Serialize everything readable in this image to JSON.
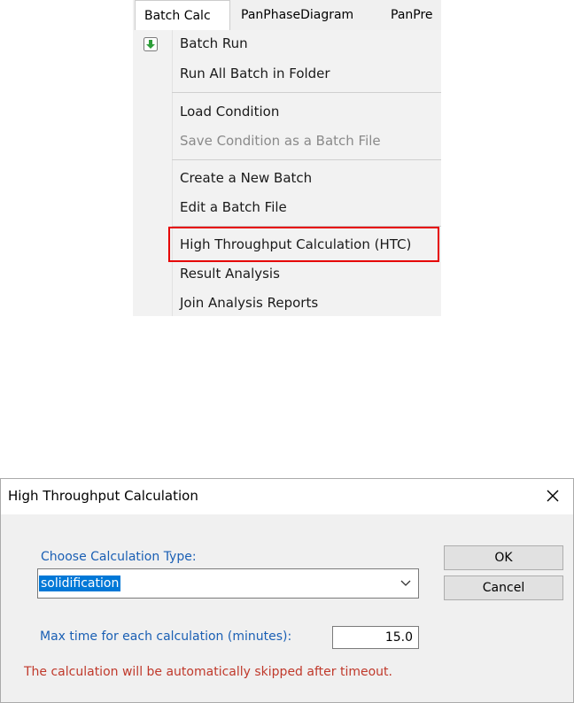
{
  "menubar": {
    "tabs": [
      "Batch Calc",
      "PanPhaseDiagram",
      "PanPre"
    ]
  },
  "menu": {
    "items": [
      {
        "label": "Batch Run",
        "disabled": false
      },
      {
        "label": "Run All Batch in Folder",
        "disabled": false
      },
      {
        "label": "Load Condition",
        "disabled": false
      },
      {
        "label": "Save Condition as a Batch File",
        "disabled": true
      },
      {
        "label": "Create a New Batch",
        "disabled": false
      },
      {
        "label": "Edit a Batch File",
        "disabled": false
      },
      {
        "label": "High Throughput Calculation (HTC)",
        "disabled": false
      },
      {
        "label": "Result Analysis",
        "disabled": false
      },
      {
        "label": "Join Analysis Reports",
        "disabled": false
      }
    ],
    "highlight_color": "#e60000",
    "run_icon": "green-down-arrow-icon"
  },
  "dialog": {
    "title": "High Throughput Calculation",
    "type_label": "Choose Calculation Type:",
    "type_value": "solidification",
    "ok_label": "OK",
    "cancel_label": "Cancel",
    "time_label": "Max time for each calculation (minutes):",
    "time_value": "15.0",
    "warning": "The calculation will be automatically skipped after timeout.",
    "label_color": "#1a5fb4",
    "warning_color": "#c0392b"
  }
}
